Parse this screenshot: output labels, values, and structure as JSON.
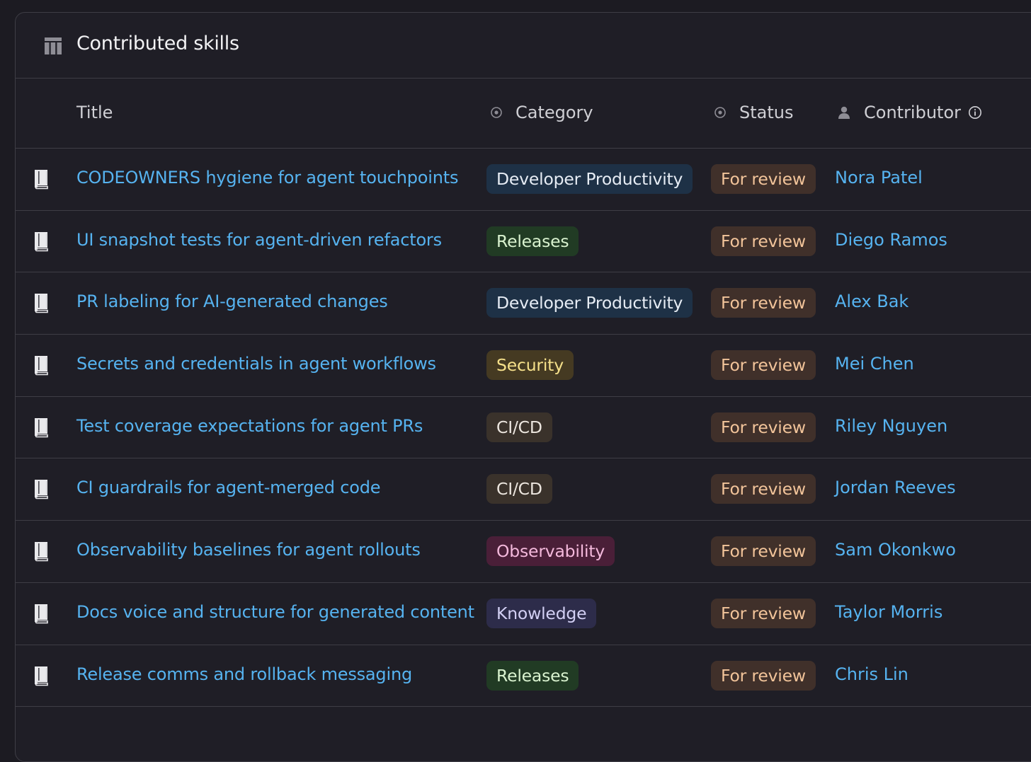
{
  "header": {
    "title": "Contributed skills",
    "icon": "table-icon"
  },
  "columns": {
    "title": "Title",
    "category": "Category",
    "status": "Status",
    "contributor": "Contributor"
  },
  "category_colors": {
    "Developer Productivity": {
      "bg": "#1e3146",
      "fg": "#e6ecf4"
    },
    "Releases": {
      "bg": "#213b24",
      "fg": "#d9f2cf"
    },
    "Security": {
      "bg": "#453a22",
      "fg": "#f5e08a"
    },
    "CI/CD": {
      "bg": "#3a322b",
      "fg": "#ece6df"
    },
    "Observability": {
      "bg": "#4a1f38",
      "fg": "#f4b9dc"
    },
    "Knowledge": {
      "bg": "#2d2c4a",
      "fg": "#d3d0f4"
    }
  },
  "rows": [
    {
      "title": "CODEOWNERS hygiene for agent touchpoints",
      "category": "Developer Productivity",
      "status": "For review",
      "contributor": "Nora Patel"
    },
    {
      "title": "UI snapshot tests for agent-driven refactors",
      "category": "Releases",
      "status": "For review",
      "contributor": "Diego Ramos"
    },
    {
      "title": "PR labeling for AI-generated changes",
      "category": "Developer Productivity",
      "status": "For review",
      "contributor": "Alex Bak"
    },
    {
      "title": "Secrets and credentials in agent workflows",
      "category": "Security",
      "status": "For review",
      "contributor": "Mei Chen"
    },
    {
      "title": "Test coverage expectations for agent PRs",
      "category": "CI/CD",
      "status": "For review",
      "contributor": "Riley Nguyen"
    },
    {
      "title": "CI guardrails for agent-merged code",
      "category": "CI/CD",
      "status": "For review",
      "contributor": "Jordan Reeves"
    },
    {
      "title": "Observability baselines for agent rollouts",
      "category": "Observability",
      "status": "For review",
      "contributor": "Sam Okonkwo"
    },
    {
      "title": "Docs voice and structure for generated content",
      "category": "Knowledge",
      "status": "For review",
      "contributor": "Taylor Morris"
    },
    {
      "title": "Release comms and rollback messaging",
      "category": "Releases",
      "status": "For review",
      "contributor": "Chris Lin"
    }
  ]
}
